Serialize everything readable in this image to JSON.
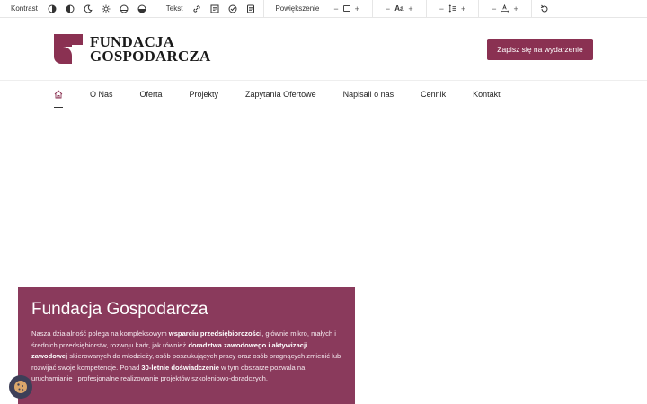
{
  "toolbar": {
    "contrast_label": "Kontrast",
    "text_label": "Tekst",
    "zoom_label": "Powiększenie",
    "font_size_label": "Aa"
  },
  "header": {
    "logo_line1": "FUNDACJA",
    "logo_line2": "GOSPODARCZA",
    "cta_label": "Zapisz się na wydarzenie",
    "brand_color": "#8a3152"
  },
  "nav": {
    "items": [
      "O Nas",
      "Oferta",
      "Projekty",
      "Zapytania Ofertowe",
      "Napisali o nas",
      "Cennik",
      "Kontakt"
    ]
  },
  "hero": {
    "title": "Fundacja Gospodarcza",
    "p1": "Nasza działalność polega na kompleksowym ",
    "b1": "wsparciu przedsiębiorczości",
    "p2": ", głównie mikro, małych i średnich przedsiębiorstw, rozwoju kadr, jak również ",
    "b2": "doradztwa zawodowego i aktywizacji zawodowej",
    "p3": " skierowanych do młodzieży, osób poszukujących pracy oraz osób pragnących zmienić lub rozwijać swoje kompetencje. Ponad ",
    "b3": "30-letnie doświadczenie",
    "p4": " w tym obszarze pozwala na uruchamianie i profesjonalne realizowanie projektów szkoleniowo-doradczych."
  }
}
